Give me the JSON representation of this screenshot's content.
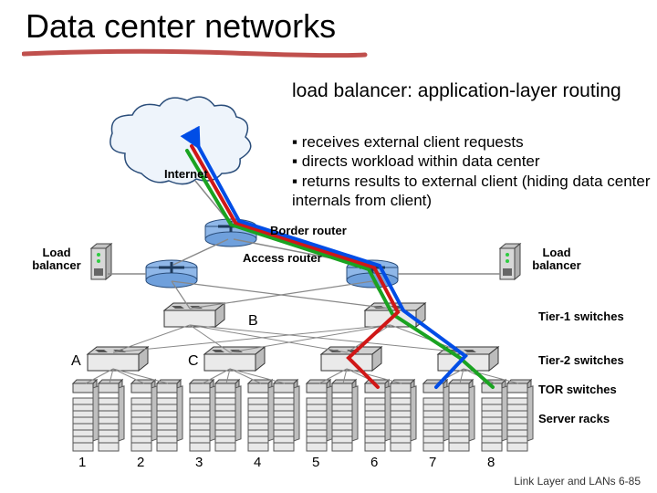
{
  "title": "Data center networks",
  "subtitle": "load balancer: application-layer routing",
  "bullets": [
    "receives external client requests",
    "directs workload within data center",
    "returns results to external client (hiding data center internals from client)"
  ],
  "labels": {
    "internet": "Internet",
    "border_router": "Border router",
    "access_router": "Access router",
    "load_balancer_left": "Load balancer",
    "load_balancer_right": "Load balancer",
    "tier1": "Tier-1 switches",
    "tier2": "Tier-2 switches",
    "tor": "TOR switches",
    "racks": "Server racks",
    "A": "A",
    "B": "B",
    "C": "C"
  },
  "rack_numbers": [
    "1",
    "2",
    "3",
    "4",
    "5",
    "6",
    "7",
    "8"
  ],
  "footer": "Link Layer and LANs   6-85"
}
